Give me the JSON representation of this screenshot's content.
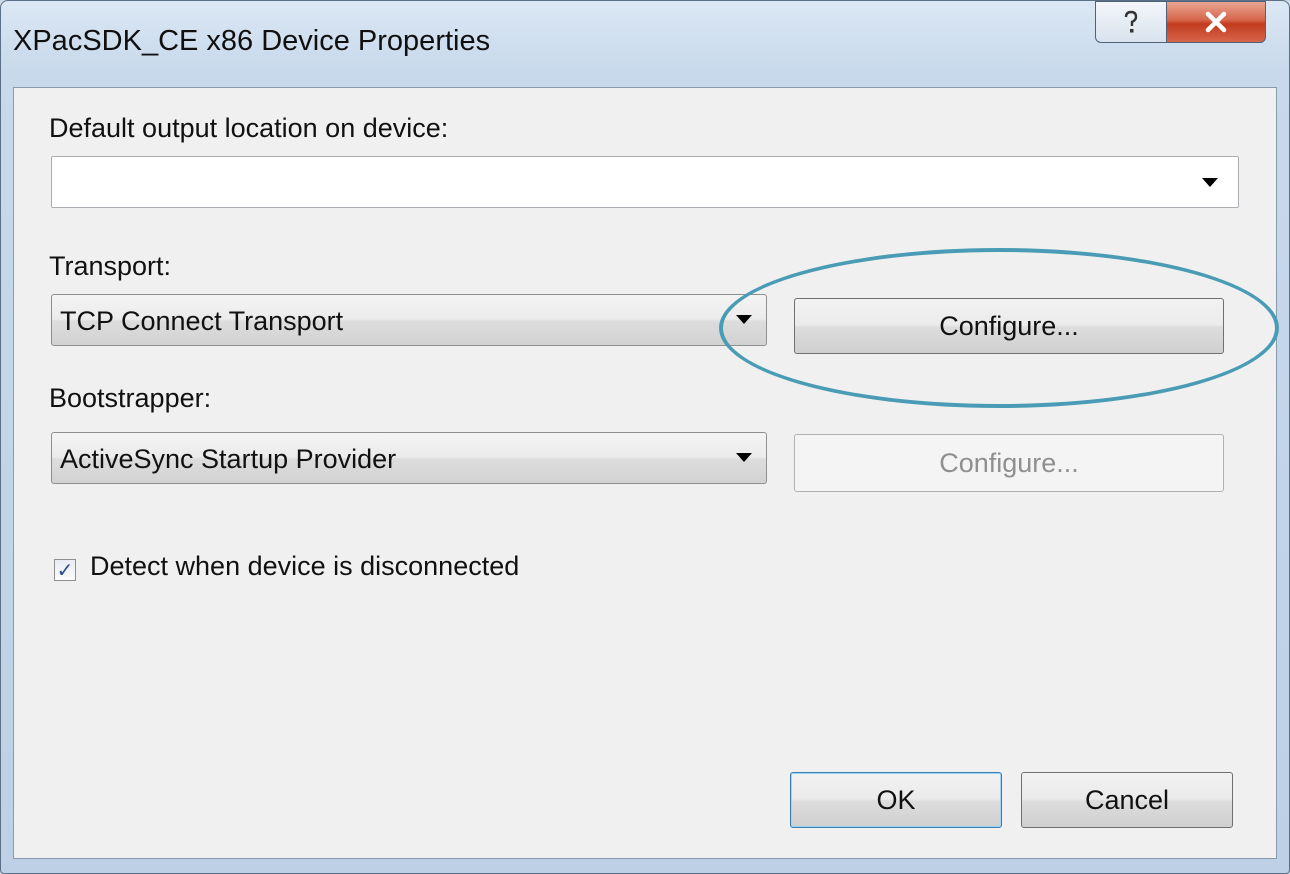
{
  "window": {
    "title": "XPacSDK_CE x86 Device Properties",
    "help_icon": "question-mark-icon",
    "close_icon": "close-x-icon"
  },
  "output_location": {
    "label": "Default output location on device:",
    "value": ""
  },
  "transport": {
    "label": "Transport:",
    "selected": "TCP Connect Transport",
    "configure_label": "Configure..."
  },
  "bootstrapper": {
    "label": "Bootstrapper:",
    "selected": "ActiveSync Startup Provider",
    "configure_label": "Configure..."
  },
  "detect_disconnect": {
    "label": "Detect when device is disconnected",
    "checked": true
  },
  "footer": {
    "ok_label": "OK",
    "cancel_label": "Cancel"
  },
  "colors": {
    "highlight_ring": "#4a9bb5",
    "close_button": "#c23b1f"
  }
}
